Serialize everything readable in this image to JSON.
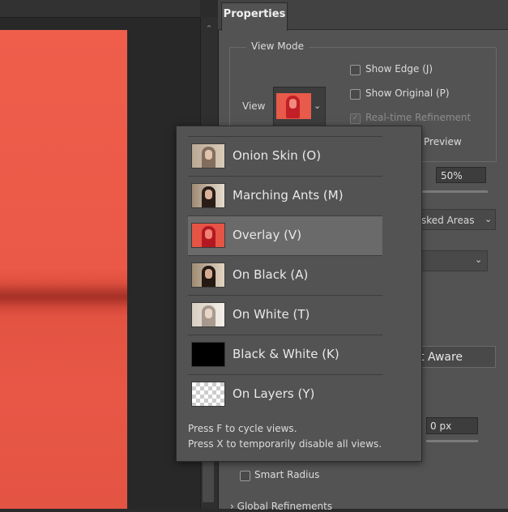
{
  "panel": {
    "tab_label": "Properties",
    "view_mode_title": "View Mode",
    "view_label": "View",
    "show_edge_label": "Show Edge (J)",
    "show_original_label": "Show Original (P)",
    "realtime_label": "Real-time Refinement",
    "realtime_checked": true,
    "preview_label": "Preview",
    "opacity_value": "50%",
    "areas_dropdown_text": "sked Areas",
    "aware_button_text": "t Aware",
    "radius_value": "0 px",
    "smart_radius_label": "Smart Radius",
    "global_refinements_label": "Global Refinements"
  },
  "view_popup": {
    "items": [
      {
        "label": "Onion Skin (O)",
        "thumb": "onion-skin",
        "selected": false
      },
      {
        "label": "Marching Ants (M)",
        "thumb": "marching-ants",
        "selected": false
      },
      {
        "label": "Overlay (V)",
        "thumb": "overlay",
        "selected": true
      },
      {
        "label": "On Black (A)",
        "thumb": "on-black",
        "selected": false
      },
      {
        "label": "On White (T)",
        "thumb": "on-white",
        "selected": false
      },
      {
        "label": "Black & White (K)",
        "thumb": "black-white",
        "selected": false
      },
      {
        "label": "On Layers (Y)",
        "thumb": "on-layers",
        "selected": false
      }
    ],
    "hint_line1": "Press F to cycle views.",
    "hint_line2": "Press X to temporarily disable all views."
  },
  "colors": {
    "canvas_red": "#ea5947",
    "panel_bg": "#535353",
    "selected_row": "#6a6a6a"
  }
}
